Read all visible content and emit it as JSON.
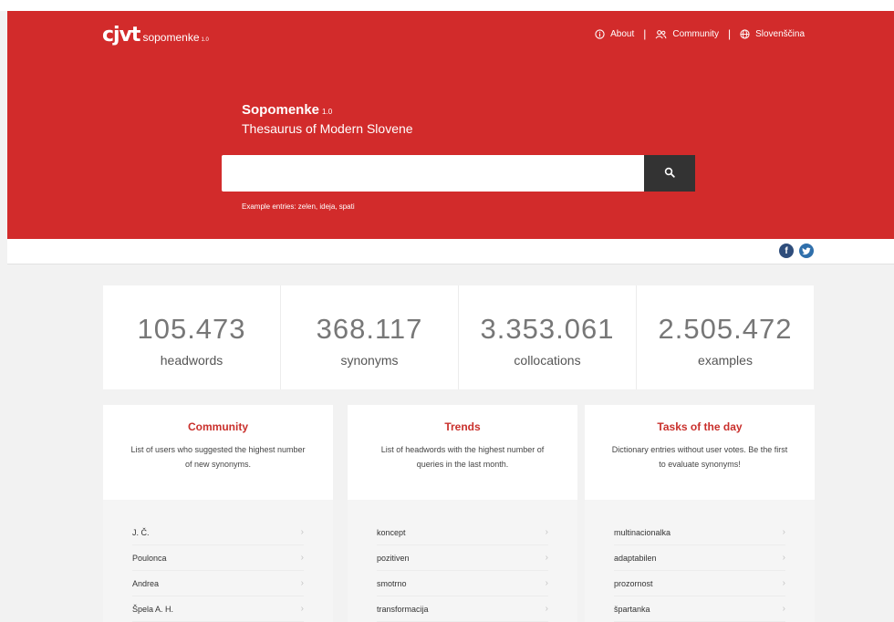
{
  "brand": {
    "mark": "cjvt",
    "name": "sopomenke",
    "version": "1.0"
  },
  "nav": {
    "about": "About",
    "community": "Community",
    "language": "Slovenščina",
    "separator": "|"
  },
  "hero": {
    "title": "Sopomenke",
    "version": "1.0",
    "subtitle": "Thesaurus of Modern Slovene",
    "search_value": "",
    "search_placeholder": "",
    "examples": "Example entries: zelen, ideja, spati"
  },
  "social": {
    "facebook": "f",
    "twitter": "t"
  },
  "stats": [
    {
      "value": "105.473",
      "label": "headwords"
    },
    {
      "value": "368.117",
      "label": "synonyms"
    },
    {
      "value": "3.353.061",
      "label": "collocations"
    },
    {
      "value": "2.505.472",
      "label": "examples"
    }
  ],
  "cards": [
    {
      "title": "Community",
      "description": "List of users who suggested the highest number of new synonyms.",
      "items": [
        "J. Č.",
        "Poulonca",
        "Andrea",
        "Špela A. H."
      ]
    },
    {
      "title": "Trends",
      "description": "List of headwords with the highest number of queries in the last month.",
      "items": [
        "koncept",
        "pozitiven",
        "smotrno",
        "transformacija"
      ]
    },
    {
      "title": "Tasks of the day",
      "description": "Dictionary entries without user votes. Be the first to evaluate synonyms!",
      "items": [
        "multinacionalka",
        "adaptabilen",
        "prozornost",
        "špartanka"
      ]
    }
  ],
  "chevron": "›",
  "colors": {
    "brand_red": "#d22b2b",
    "accent_red": "#c9302c",
    "dark_button": "#333333"
  }
}
